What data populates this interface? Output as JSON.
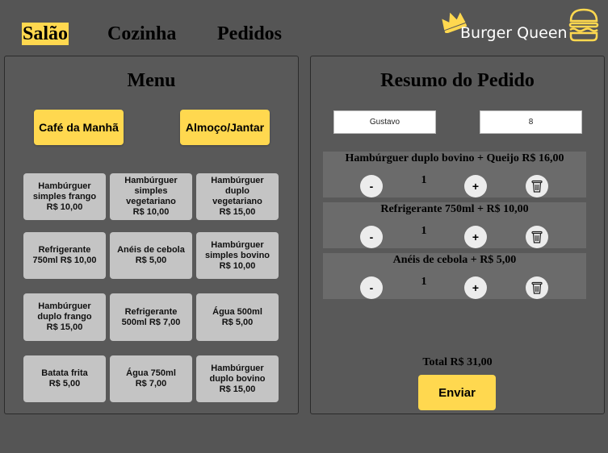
{
  "nav": {
    "tabs": [
      {
        "label": "Salão",
        "active": true
      },
      {
        "label": "Cozinha",
        "active": false
      },
      {
        "label": "Pedidos",
        "active": false
      }
    ]
  },
  "brand": {
    "name": "Burger Queen",
    "icon": "burger-icon",
    "crown_icon": "crown-icon"
  },
  "colors": {
    "accent": "#ffd84f",
    "background": "#555555",
    "panel": "#595959",
    "card": "#c4c4c4"
  },
  "menu": {
    "title": "Menu",
    "categories": [
      "Café da Manhã",
      "Almoço/Jantar"
    ],
    "items": [
      {
        "name": "Hambúrguer simples frango",
        "price": "R$ 10,00"
      },
      {
        "name": "Hambúrguer simples vegetariano",
        "price": "R$ 10,00"
      },
      {
        "name": "Hambúrguer duplo vegetariano",
        "price": "R$ 15,00"
      },
      {
        "name": "Refrigerante 750ml",
        "price": "R$ 10,00"
      },
      {
        "name": "Anéis de cebola",
        "price": "R$ 5,00"
      },
      {
        "name": "Hambúrguer simples bovino",
        "price": "R$ 10,00"
      },
      {
        "name": "Hambúrguer duplo frango",
        "price": "R$ 15,00"
      },
      {
        "name": "Refrigerante 500ml",
        "price": "R$ 7,00"
      },
      {
        "name": "Água 500ml",
        "price": "R$ 5,00"
      },
      {
        "name": "Batata frita",
        "price": "R$ 5,00"
      },
      {
        "name": "Água 750ml",
        "price": "R$ 7,00"
      },
      {
        "name": "Hambúrguer duplo bovino",
        "price": "R$ 15,00"
      }
    ]
  },
  "order": {
    "title": "Resumo do Pedido",
    "client_name": "Gustavo",
    "table_number": "8",
    "items": [
      {
        "label": "Hambúrguer duplo bovino + Queijo R$ 16,00",
        "qty": "1"
      },
      {
        "label": "Refrigerante 750ml + R$ 10,00",
        "qty": "1"
      },
      {
        "label": "Anéis de cebola + R$ 5,00",
        "qty": "1"
      }
    ],
    "minus_label": "-",
    "plus_label": "+",
    "delete_icon": "trash-icon",
    "total": "Total R$ 31,00",
    "send_label": "Enviar"
  }
}
